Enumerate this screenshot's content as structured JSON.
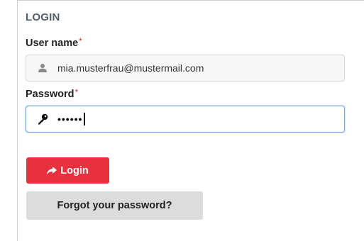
{
  "form": {
    "title": "LOGIN",
    "username_label": "User name",
    "password_label": "Password",
    "required_marker": "*",
    "username_value": "mia.musterfrau@mustermail.com",
    "password_value": "••••••",
    "username_icon": "user-icon",
    "password_icon": "key-icon"
  },
  "buttons": {
    "login_label": "Login",
    "login_icon": "share-arrow-icon",
    "forgot_label": "Forgot your password?"
  },
  "colors": {
    "accent": "#e8313e",
    "required": "#e0303a",
    "focus_border": "#6fa6d8",
    "secondary_button": "#dcdcdc",
    "title": "#555f6a"
  }
}
